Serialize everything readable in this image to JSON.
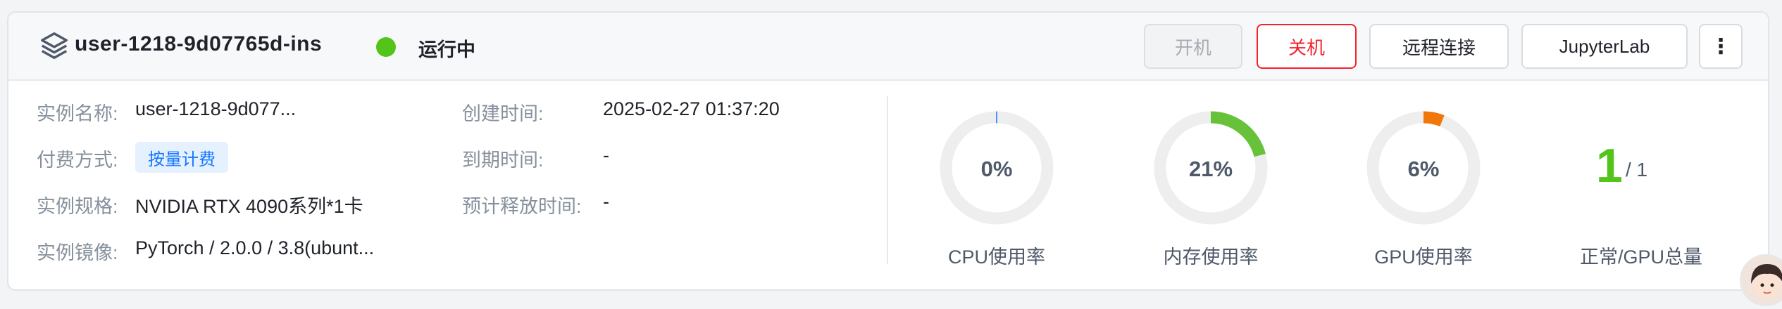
{
  "instance": {
    "title": "user-1218-9d07765d-ins",
    "status_text": "运行中",
    "status_color": "#52c41a"
  },
  "buttons": {
    "start_label": "开机",
    "stop_label": "关机",
    "remote_label": "远程连接",
    "jupyter_label": "JupyterLab",
    "more_label": "⋮"
  },
  "info": {
    "name_label": "实例名称:",
    "name_value": "user-1218-9d077...",
    "billing_label": "付费方式:",
    "billing_value": "按量计费",
    "spec_label": "实例规格:",
    "spec_value": "NVIDIA RTX 4090系列*1卡",
    "image_label": "实例镜像:",
    "image_value": "PyTorch / 2.0.0 / 3.8(ubunt...",
    "created_label": "创建时间:",
    "created_value": "2025-02-27 01:37:20",
    "expire_label": "到期时间:",
    "expire_value": "-",
    "release_label": "预计释放时间:",
    "release_value": "-"
  },
  "metrics": {
    "cpu": {
      "value": 0,
      "text": "0%",
      "label": "CPU使用率",
      "color": "#1677ff"
    },
    "mem": {
      "value": 21,
      "text": "21%",
      "label": "内存使用率",
      "color": "#67c23a"
    },
    "gpu": {
      "value": 6,
      "text": "6%",
      "label": "GPU使用率",
      "color": "#f0780a"
    },
    "gpu_count": {
      "normal": "1",
      "total": "/ 1",
      "label": "正常/GPU总量"
    }
  },
  "icons": [
    "layers-icon",
    "status-dot-icon",
    "more-vertical-icon",
    "avatar"
  ]
}
